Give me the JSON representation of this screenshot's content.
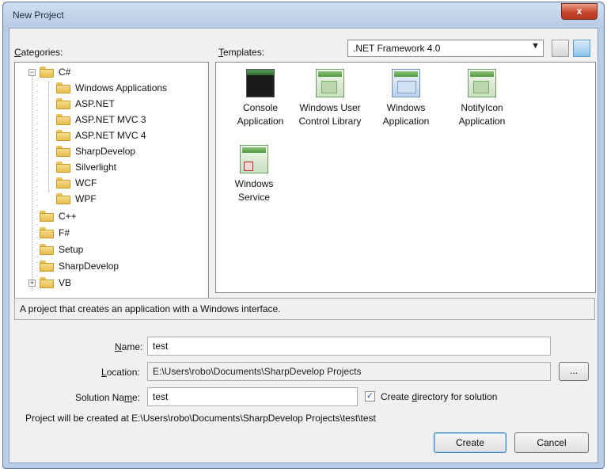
{
  "window": {
    "title": "New Project",
    "close_glyph": "x"
  },
  "categories": {
    "label": "Categories:",
    "label_underline": "C",
    "label_rest": "ategories:",
    "tree": [
      {
        "label": "C#",
        "expanded": true,
        "children": [
          "Windows Applications",
          "ASP.NET",
          "ASP.NET MVC 3",
          "ASP.NET MVC 4",
          "SharpDevelop",
          "Silverlight",
          "WCF",
          "WPF"
        ]
      },
      {
        "label": "C++"
      },
      {
        "label": "F#"
      },
      {
        "label": "Setup"
      },
      {
        "label": "SharpDevelop"
      },
      {
        "label": "VB",
        "expanded": false
      }
    ],
    "items": {
      "csharp": "C#",
      "win_apps": "Windows Applications",
      "aspnet": "ASP.NET",
      "mvc3": "ASP.NET MVC 3",
      "mvc4": "ASP.NET MVC 4",
      "sharpdev_sub": "SharpDevelop",
      "silverlight": "Silverlight",
      "wcf": "WCF",
      "wpf": "WPF",
      "cpp": "C++",
      "fsharp": "F#",
      "setup": "Setup",
      "sharpdev": "SharpDevelop",
      "vb": "VB"
    }
  },
  "templates": {
    "label_underline": "T",
    "label_rest": "emplates:",
    "framework": ".NET Framework 4.0",
    "items": [
      {
        "line1": "Console",
        "line2": "Application",
        "icon": "console-icon"
      },
      {
        "line1": "Windows User",
        "line2": "Control Library",
        "icon": "user-control-icon"
      },
      {
        "line1": "Windows",
        "line2": "Application",
        "icon": "windows-app-icon"
      },
      {
        "line1": "NotifyIcon",
        "line2": "Application",
        "icon": "notifyicon-icon"
      },
      {
        "line1": "Windows",
        "line2": "Service",
        "icon": "service-icon"
      }
    ]
  },
  "description": "A project that creates an application with a Windows interface.",
  "form": {
    "name_underline": "N",
    "name_rest": "ame:",
    "name_value": "test",
    "location_underline": "L",
    "location_rest": "ocation:",
    "location_value": "E:\\Users\\robo\\Documents\\SharpDevelop Projects",
    "browse_label": "...",
    "solution_pre": "Solution Na",
    "solution_underline": "m",
    "solution_rest": "e:",
    "solution_value": "test",
    "create_dir_pre": "Create ",
    "create_dir_underline": "d",
    "create_dir_rest": "irectory for solution",
    "create_dir_checked": "✓",
    "path_info": "Project will be created at E:\\Users\\robo\\Documents\\SharpDevelop Projects\\test\\test"
  },
  "buttons": {
    "create": "Create",
    "cancel": "Cancel"
  },
  "colors": {
    "titlebar": "#b6cae3",
    "close": "#c8452b",
    "dialog_bg": "#f0f0f0",
    "folder": "#e6bd4f"
  }
}
